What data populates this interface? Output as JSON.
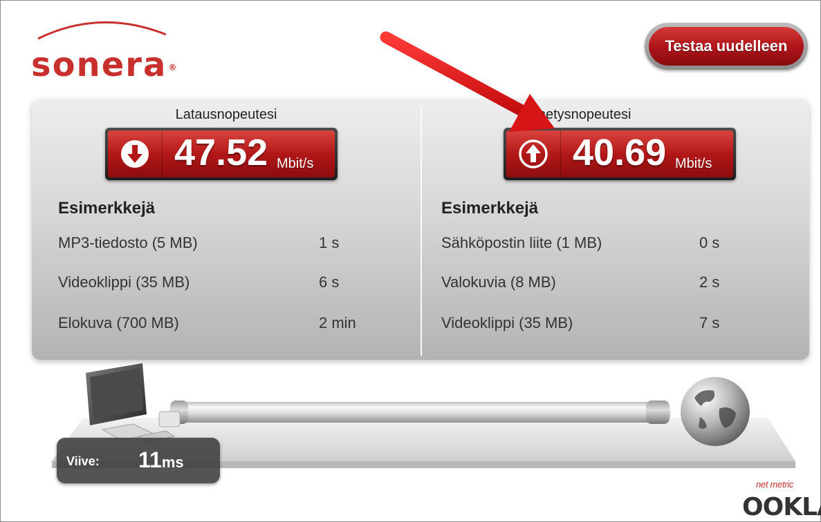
{
  "brand": {
    "name": "sonera",
    "reg_mark": "®",
    "color": "#c8302e"
  },
  "header": {
    "retest_label": "Testaa uudelleen"
  },
  "download": {
    "title": "Latausnopeutesi",
    "value": "47.52",
    "unit": "Mbit/s",
    "icon": "down-arrow-icon",
    "examples_title": "Esimerkkejä",
    "examples": [
      {
        "label": "MP3-tiedosto (5 MB)",
        "time": "1 s"
      },
      {
        "label": "Videoklippi (35 MB)",
        "time": "6 s"
      },
      {
        "label": "Elokuva (700 MB)",
        "time": "2 min"
      }
    ]
  },
  "upload": {
    "title": "Lähetysnopeutesi",
    "value": "40.69",
    "unit": "Mbit/s",
    "icon": "up-arrow-icon",
    "examples_title": "Esimerkkejä",
    "examples": [
      {
        "label": "Sähköpostin liite (1 MB)",
        "time": "0 s"
      },
      {
        "label": "Valokuvia (8 MB)",
        "time": "2 s"
      },
      {
        "label": "Videoklippi (35 MB)",
        "time": "7 s"
      }
    ]
  },
  "latency": {
    "label": "Viive:",
    "value": "11",
    "unit": "ms"
  },
  "footer": {
    "powered_net": "net metric",
    "powered_word": "OOKLA"
  },
  "colors": {
    "accent_red": "#b21818",
    "annotation_red": "#e2191b",
    "panel_gray": "#d6d6d6"
  }
}
